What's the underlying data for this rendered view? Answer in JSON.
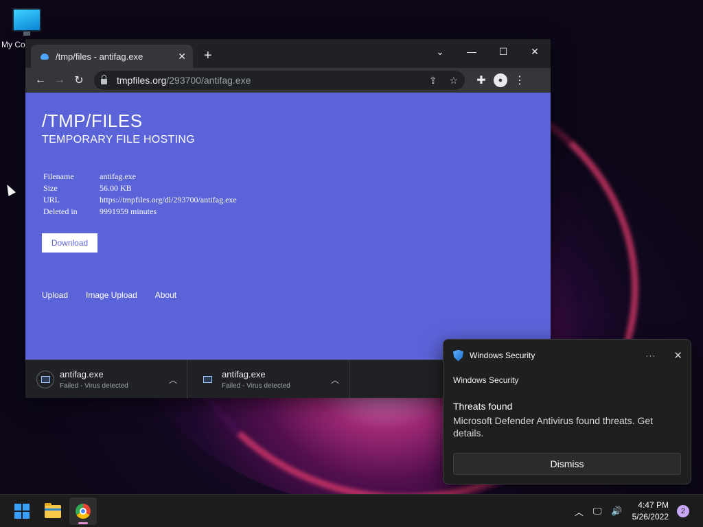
{
  "desktop": {
    "icon_label": "My Co"
  },
  "browser": {
    "tab_title": "/tmp/files - antifag.exe",
    "new_tab": "+",
    "url_host": "tmpfiles.org",
    "url_path": "/293700/antifag.exe"
  },
  "page": {
    "title": "/TMP/FILES",
    "subtitle": "TEMPORARY FILE HOSTING",
    "info": [
      {
        "key": "Filename",
        "value": "antifag.exe"
      },
      {
        "key": "Size",
        "value": "56.00 KB"
      },
      {
        "key": "URL",
        "value": "https://tmpfiles.org/dl/293700/antifag.exe"
      },
      {
        "key": "Deleted in",
        "value": "9991959 minutes"
      }
    ],
    "download_label": "Download",
    "links": [
      "Upload",
      "Image Upload",
      "About"
    ]
  },
  "downloads": [
    {
      "name": "antifag.exe",
      "status": "Failed - Virus detected"
    },
    {
      "name": "antifag.exe",
      "status": "Failed - Virus detected"
    }
  ],
  "toast": {
    "app": "Windows Security",
    "more": "···",
    "source": "Windows Security",
    "title": "Threats found",
    "body": "Microsoft Defender Antivirus found threats. Get details.",
    "dismiss": "Dismiss"
  },
  "taskbar": {
    "time": "4:47 PM",
    "date": "5/26/2022",
    "notifications": "2"
  },
  "colors": {
    "page_bg": "#5b63d9",
    "chrome_dark": "#202124",
    "toast_bg": "#1f1f1f",
    "accent_notif": "#c9a6f5"
  }
}
